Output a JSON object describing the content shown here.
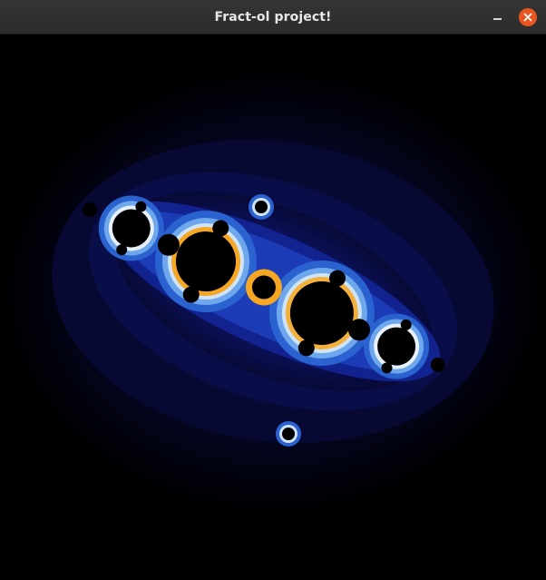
{
  "window": {
    "title": "Fract-ol project!",
    "controls": {
      "minimize": "minimize-icon",
      "close": "close-icon"
    }
  },
  "canvas": {
    "fractal": "julia-set",
    "colors": {
      "background": "#000000",
      "outer_glow": "#05051a",
      "mid_glow": "#0a0d3c",
      "deep_blue": "#0f2a9a",
      "blue": "#2f6fd8",
      "light_blue": "#a9d1f5",
      "white": "#f2f6fb",
      "orange": "#f5a623",
      "interior": "#000000"
    }
  },
  "accent_close": "#e9541f"
}
